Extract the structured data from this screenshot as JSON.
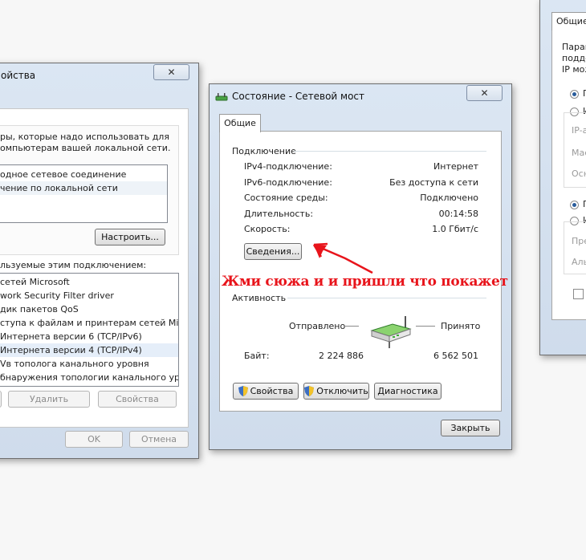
{
  "left_window": {
    "title": "ойства",
    "close": "✕",
    "desc_line1": "ры, которые надо использовать для",
    "desc_line2": "омпьютерам вашей локальной сети.",
    "connections": [
      "одное сетевое соединение",
      "чение по локальной сети"
    ],
    "configure_button": "Настроить...",
    "components_label": "льзуемые этим подключением:",
    "components": [
      "сетей Microsoft",
      "work Security Filter driver",
      "дик пакетов QoS",
      "ступа к файлам и принтерам сетей Micro...",
      "Интернета версии 6 (TCP/IPv6)",
      "Интернета версии 4 (TCP/IPv4)",
      "Vв тополога канального уровня",
      "бнаружения топологии канального уровня"
    ],
    "remove_button": "Удалить",
    "properties_button": "Свойства",
    "ok_button": "OK",
    "cancel_button": "Отмена"
  },
  "status_window": {
    "title": "Состояние - Сетевой мост",
    "close": "✕",
    "tab": "Общие",
    "connection_group": "Подключение",
    "rows": [
      {
        "label": "IPv4-подключение:",
        "value": "Интернет"
      },
      {
        "label": "IPv6-подключение:",
        "value": "Без доступа к сети"
      },
      {
        "label": "Состояние среды:",
        "value": "Подключено"
      },
      {
        "label": "Длительность:",
        "value": "00:14:58"
      },
      {
        "label": "Скорость:",
        "value": "1.0 Гбит/с"
      }
    ],
    "details_button": "Сведения...",
    "activity_group": "Активность",
    "sent_label": "Отправлено",
    "received_label": "Принято",
    "bytes_label": "Байт:",
    "bytes_sent": "2 224 886",
    "bytes_received": "6 562 501",
    "properties_button": "Свойства",
    "disable_button": "Отключить",
    "diagnose_button": "Диагностика",
    "close_button": "Закрыть"
  },
  "annotation": {
    "text": "Жми сюжа и и пришли что покажет",
    "color": "#e8141b"
  },
  "right_window": {
    "tab": "Общие",
    "text1": "Парам",
    "text2": "подде",
    "text3": "IP мож",
    "radio1": "П",
    "radio2": "И",
    "field1": "IP-а",
    "field2": "Мас",
    "field3": "Осн",
    "radio3": "П",
    "radio4": "И",
    "field4": "Пре",
    "field5": "Аль"
  },
  "colors": {
    "frame": "#d3dfee",
    "accent_red": "#e8141b",
    "router_green": "#3fae3a"
  }
}
